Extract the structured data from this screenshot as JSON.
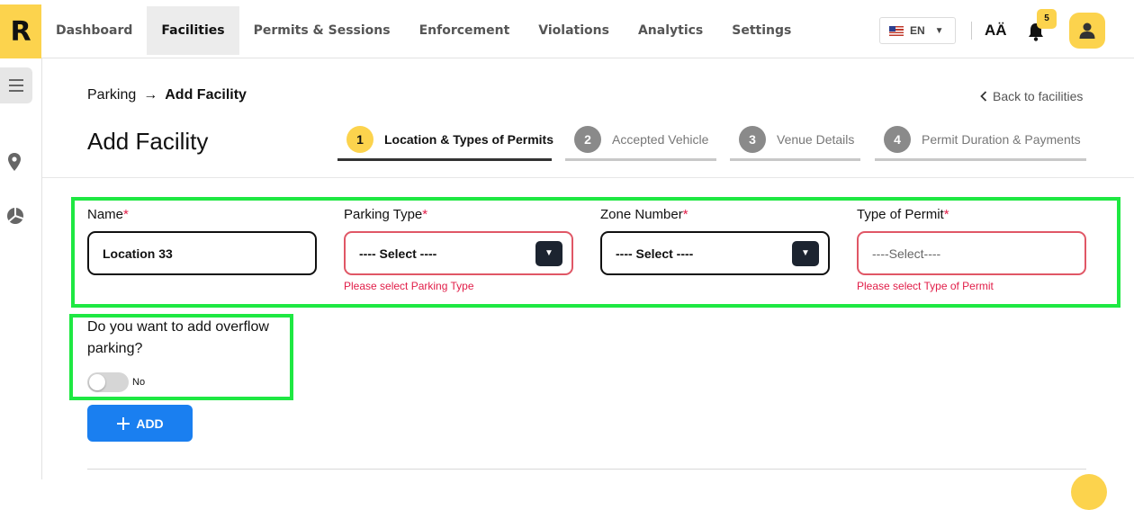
{
  "brand": {
    "logo_letter": "R"
  },
  "nav": {
    "items": [
      {
        "label": "Dashboard"
      },
      {
        "label": "Facilities",
        "active": true
      },
      {
        "label": "Permits & Sessions"
      },
      {
        "label": "Enforcement"
      },
      {
        "label": "Violations"
      },
      {
        "label": "Analytics"
      },
      {
        "label": "Settings"
      }
    ]
  },
  "header_tools": {
    "language": "EN",
    "font_icon_text": "AÄ",
    "notification_count": "5"
  },
  "breadcrumb": {
    "parent": "Parking",
    "separator": "→",
    "current": "Add Facility"
  },
  "back_link": "Back to facilities",
  "page_title": "Add Facility",
  "steps": [
    {
      "number": "1",
      "label": "Location & Types of Permits",
      "active": true
    },
    {
      "number": "2",
      "label": "Accepted Vehicle"
    },
    {
      "number": "3",
      "label": "Venue Details"
    },
    {
      "number": "4",
      "label": "Permit Duration & Payments"
    }
  ],
  "form": {
    "required_mark": "*",
    "name": {
      "label": "Name",
      "value": "Location 33"
    },
    "parking_type": {
      "label": "Parking Type",
      "value": "---- Select ----",
      "error": "Please select Parking Type"
    },
    "zone_number": {
      "label": "Zone Number",
      "value": "---- Select ----"
    },
    "permit_type": {
      "label": "Type of Permit",
      "placeholder": "----Select----",
      "error": "Please select Type of Permit"
    },
    "overflow": {
      "question": "Do you want to add overflow parking?",
      "toggle_state": "No",
      "enabled": false
    },
    "add_button": "ADD"
  },
  "colors": {
    "accent_yellow": "#fcd34d",
    "primary_blue": "#1a7ff0",
    "error_red": "#e11d48",
    "highlight_green": "#1ee842"
  }
}
